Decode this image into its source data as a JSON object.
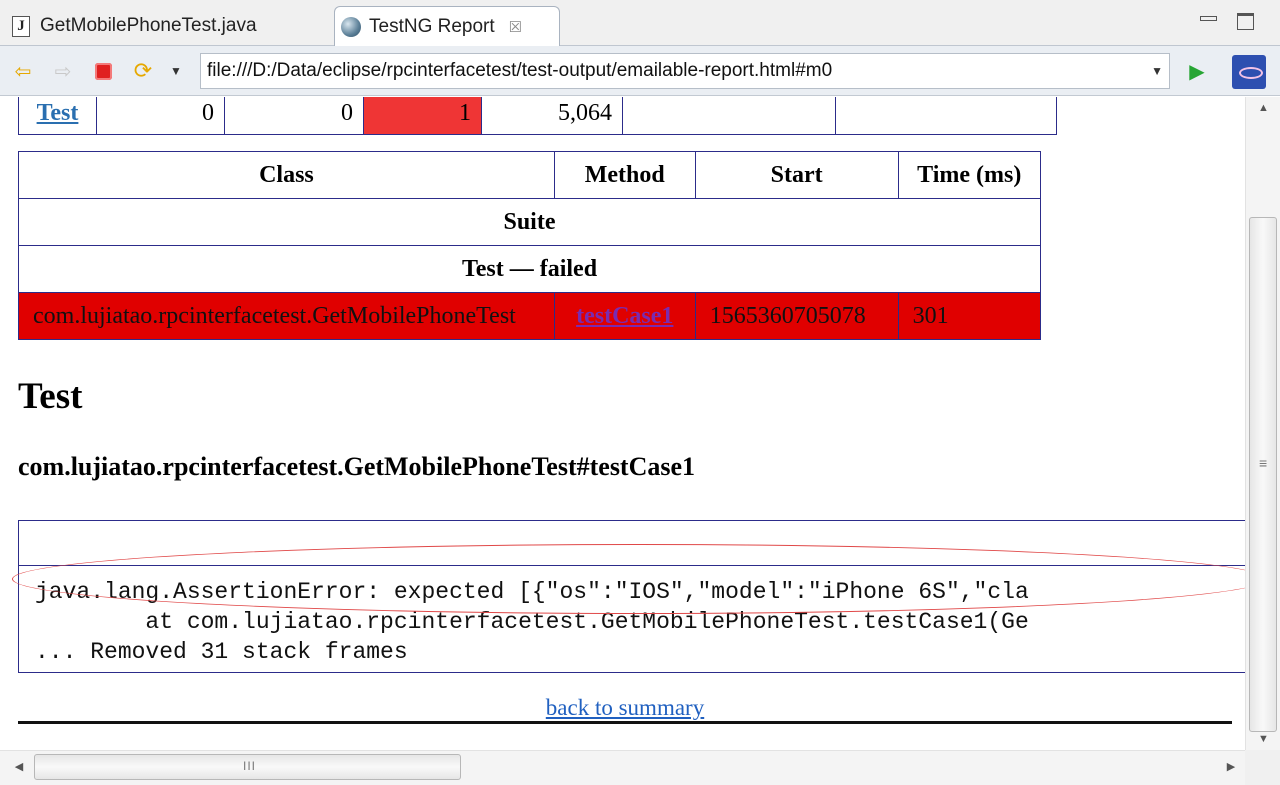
{
  "tabs": [
    {
      "label": "GetMobilePhoneTest.java",
      "icon": "java-file-icon"
    },
    {
      "label": "TestNG Report",
      "icon": "globe-icon",
      "close": "☒"
    }
  ],
  "toolbar": {
    "url": "file:///D:/Data/eclipse/rpcinterfacetest/test-output/emailable-report.html#m0"
  },
  "summary_row": {
    "name": "Test",
    "cells": [
      "0",
      "0",
      "1",
      "5,064",
      "",
      ""
    ]
  },
  "main_table": {
    "headers": [
      "Class",
      "Method",
      "Start",
      "Time (ms)"
    ],
    "suite_label": "Suite",
    "section_label": "Test — failed",
    "fail_row": {
      "class": "com.lujiatao.rpcinterfacetest.GetMobilePhoneTest",
      "method": "testCase1",
      "start": "1565360705078",
      "time": "301"
    }
  },
  "details": {
    "heading": "Test",
    "method_heading": "com.lujiatao.rpcinterfacetest.GetMobilePhoneTest#testCase1",
    "trace_lines": [
      "java.lang.AssertionError: expected [{\"os\":\"IOS\",\"model\":\"iPhone 6S\",\"cla",
      "        at com.lujiatao.rpcinterfacetest.GetMobilePhoneTest.testCase1(Ge",
      "... Removed 31 stack frames"
    ]
  },
  "back_link": "back to summary",
  "scrollbars": {
    "v_grip": "≡",
    "h_grip": "III"
  },
  "colors": {
    "fail_cell": "#ef3535",
    "fail_row": "#e00000",
    "border": "#2c2c8a",
    "link": "#2060c0",
    "annotation": "#e04848"
  }
}
